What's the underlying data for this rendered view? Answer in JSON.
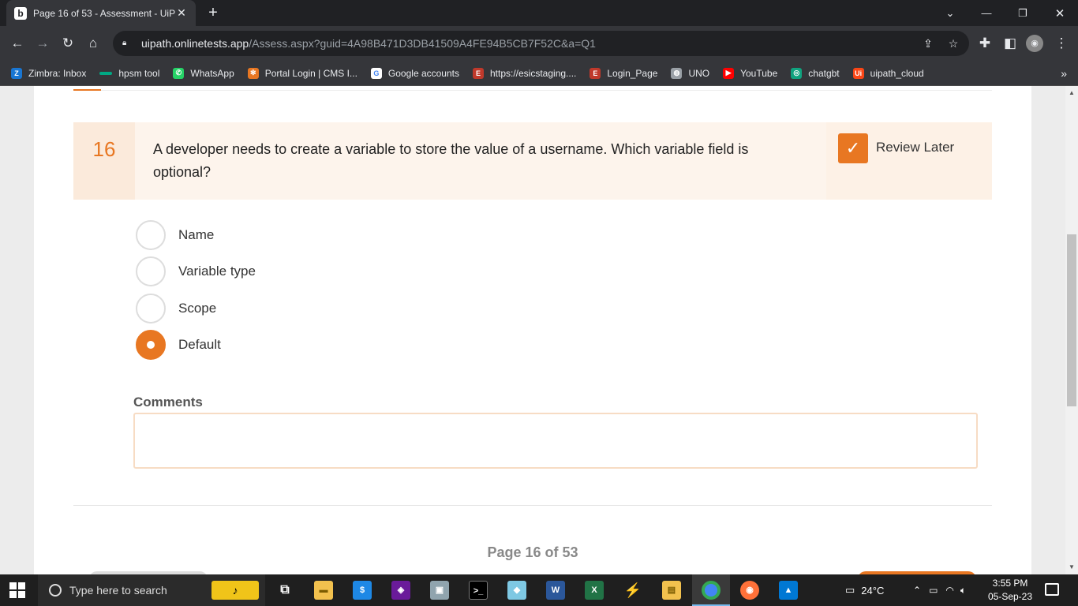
{
  "browser": {
    "tab_title": "Page 16 of 53 - Assessment - UiP",
    "tab_close": "✕",
    "new_tab": "+",
    "url_host": "uipath.onlinetests.app",
    "url_path": "/Assess.aspx?guid=4A98B471D3DB41509A4FE94B5CB7F52C&a=Q1",
    "bookmarks": [
      {
        "label": "Zimbra: Inbox",
        "icon": "zimbra-icon",
        "glyph": "Z",
        "color": "#1976d2"
      },
      {
        "label": "hpsm tool",
        "icon": "hpsm-icon",
        "glyph": "",
        "color": "#00a884"
      },
      {
        "label": "WhatsApp",
        "icon": "whatsapp-icon",
        "glyph": "✆",
        "color": "#25d366"
      },
      {
        "label": "Portal Login | CMS I...",
        "icon": "portal-icon",
        "glyph": "✻",
        "color": "#e87722"
      },
      {
        "label": "Google accounts",
        "icon": "google-icon",
        "glyph": "G",
        "color": "#ffffff"
      },
      {
        "label": "https://esicstaging....",
        "icon": "esic-icon",
        "glyph": "E",
        "color": "#c0392b"
      },
      {
        "label": "Login_Page",
        "icon": "login-page-icon",
        "glyph": "E",
        "color": "#c0392b"
      },
      {
        "label": "UNO",
        "icon": "globe-icon",
        "glyph": "◍",
        "color": "#9aa0a6"
      },
      {
        "label": "YouTube",
        "icon": "youtube-icon",
        "glyph": "▶",
        "color": "#ff0000"
      },
      {
        "label": "chatgbt",
        "icon": "chatgpt-icon",
        "glyph": "◎",
        "color": "#10a37f"
      },
      {
        "label": "uipath_cloud",
        "icon": "uipath-icon",
        "glyph": "Ui",
        "color": "#fa4616"
      }
    ]
  },
  "question": {
    "number": "16",
    "text": "A developer needs to create a variable to store the value of a username. Which variable field is optional?",
    "review_label": "Review Later",
    "review_checked": true,
    "options": [
      {
        "label": "Name",
        "selected": false
      },
      {
        "label": "Variable type",
        "selected": false
      },
      {
        "label": "Scope",
        "selected": false
      },
      {
        "label": "Default",
        "selected": true
      }
    ]
  },
  "comments": {
    "label": "Comments",
    "value": ""
  },
  "pagination": {
    "text": "Page 16 of 53"
  },
  "taskbar": {
    "search_placeholder": "Type here to search",
    "weather": "24°C",
    "time": "3:55 PM",
    "date": "05-Sep-23"
  },
  "colors": {
    "accent": "#e87722",
    "question_bg": "#fdf4ec"
  }
}
